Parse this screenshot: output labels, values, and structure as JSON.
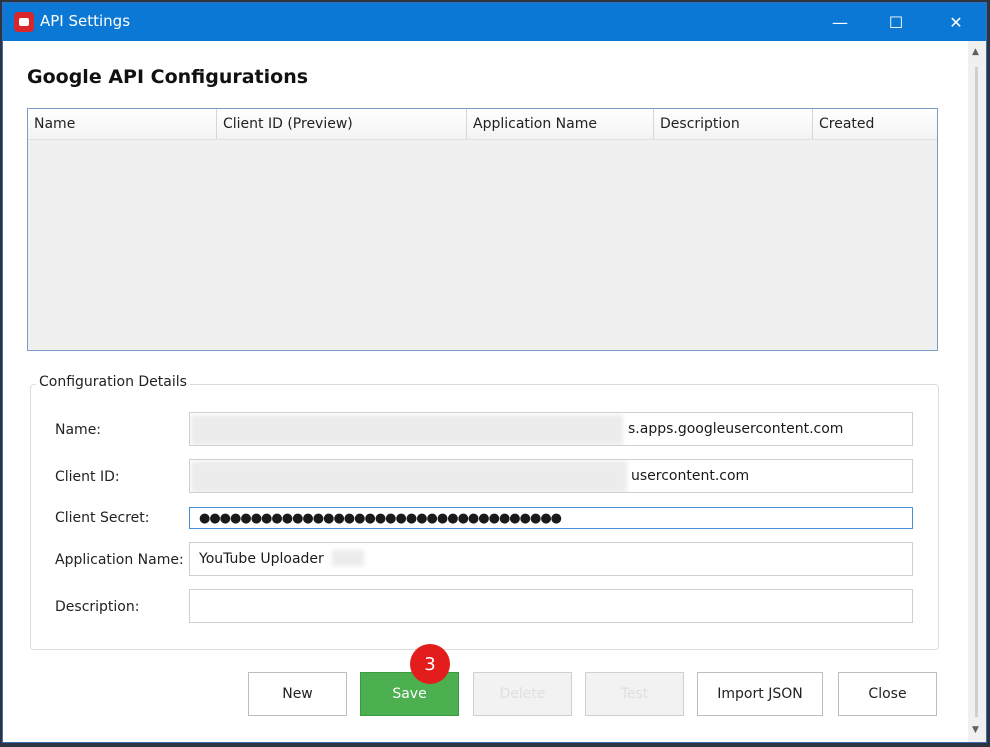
{
  "window": {
    "title": "API Settings",
    "minimize_glyph": "—",
    "maximize_glyph": "☐",
    "close_glyph": "✕"
  },
  "heading": "Google API Configurations",
  "grid": {
    "columns": [
      "Name",
      "Client ID (Preview)",
      "Application Name",
      "Description",
      "Created"
    ],
    "rows": []
  },
  "details": {
    "legend": "Configuration Details",
    "name_label": "Name:",
    "name_value_visible": "s.apps.googleusercontent.com",
    "client_id_label": "Client ID:",
    "client_id_value_visible": "usercontent.com",
    "client_secret_label": "Client Secret:",
    "client_secret_value": "●●●●●●●●●●●●●●●●●●●●●●●●●●●●●●●●●●●",
    "application_name_label": "Application Name:",
    "application_name_value": "YouTube Uploader",
    "description_label": "Description:",
    "description_value": ""
  },
  "buttons": {
    "new": "New",
    "save": "Save",
    "delete": "Delete",
    "test": "Test",
    "import_json": "Import JSON",
    "close": "Close"
  },
  "badge": "3",
  "colors": {
    "titlebar": "#0a78d4",
    "save_button": "#4caf50",
    "badge": "#e31c1c"
  }
}
